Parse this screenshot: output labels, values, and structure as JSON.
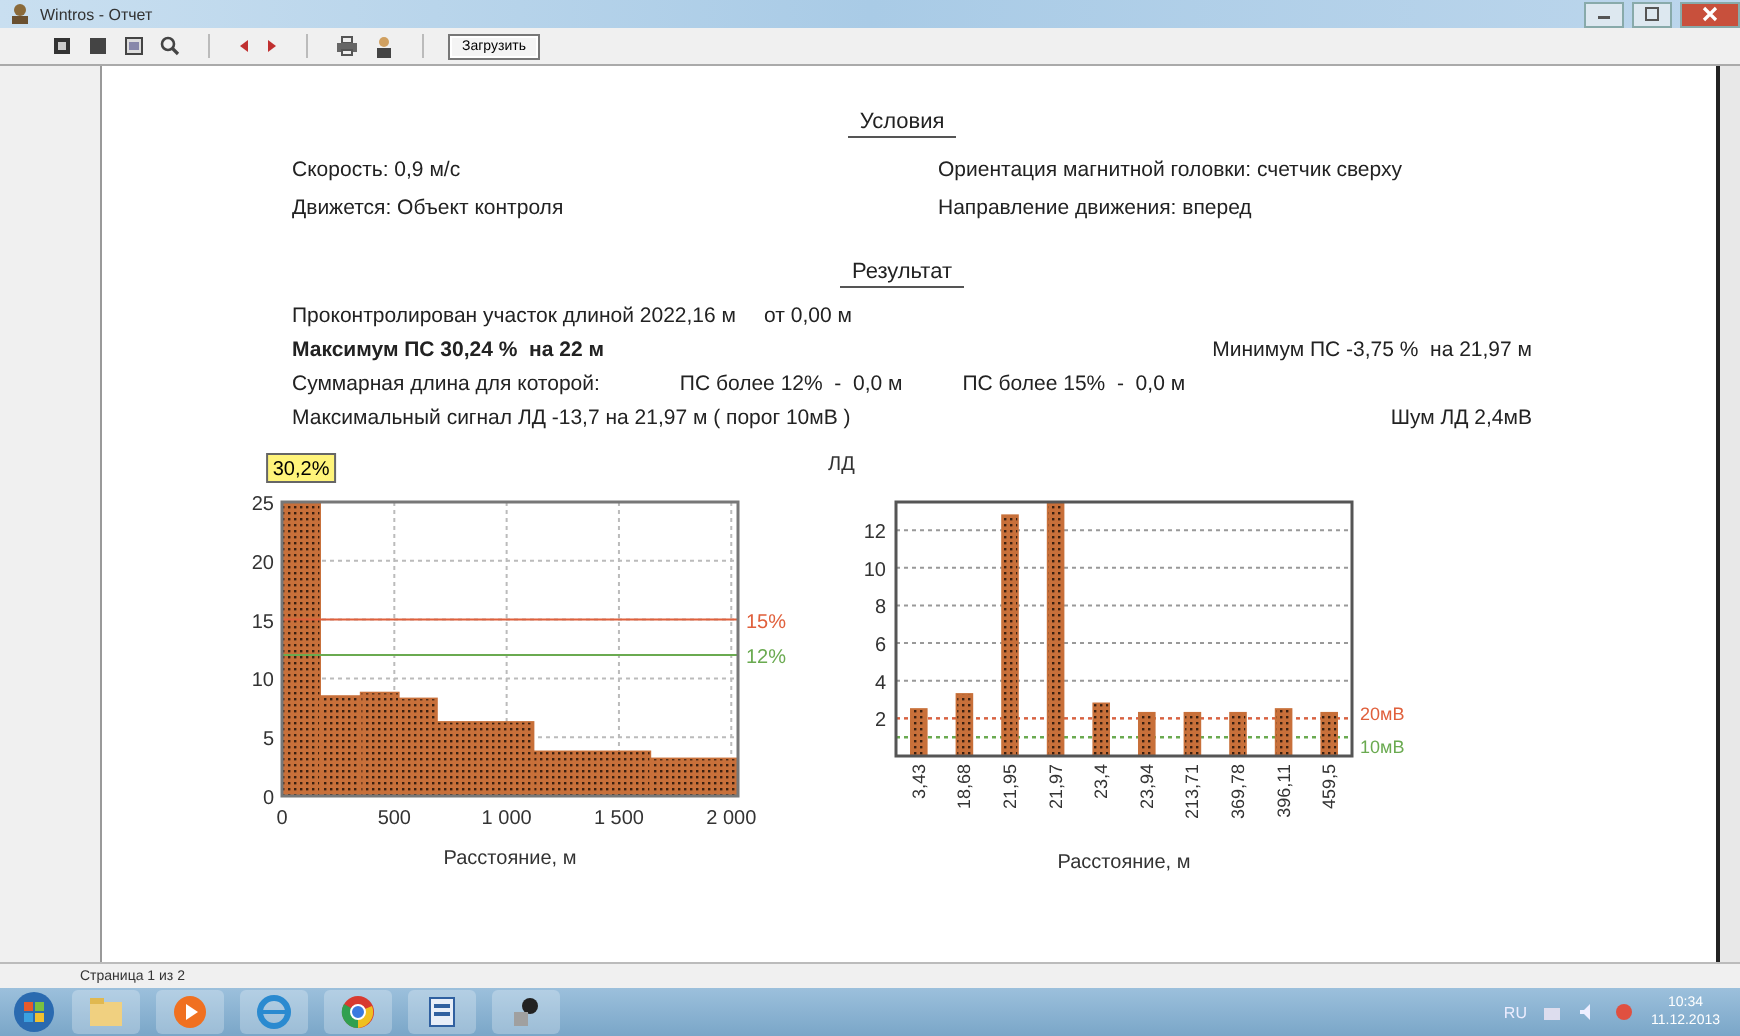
{
  "window": {
    "title": "Wintros - Отчет"
  },
  "toolbar": {
    "button": "Загрузить"
  },
  "report": {
    "conditions": {
      "heading": "Условия",
      "left": [
        "Скорость: 0,9 м/с",
        "Движется: Объект контроля"
      ],
      "right": [
        "Ориентация магнитной головки: счетчик сверху",
        "Направление движения: вперед"
      ]
    },
    "result": {
      "heading": "Результат",
      "rows": [
        {
          "cells": [
            {
              "text": "Проконтролирован участок длиной 2022,16 м",
              "bold": false
            },
            {
              "text": "от 0,00 м",
              "bold": false
            }
          ]
        },
        {
          "cells": [
            {
              "text": "Максимум ПС 30,24 %  на 22 м",
              "bold": true
            }
          ],
          "right": "Минимум ПС -3,75 %  на 21,97 м"
        },
        {
          "cells": [
            {
              "text": "Суммарная длина для которой:",
              "bold": false
            },
            {
              "text": "ПС более 12%  -  0,0 м",
              "bold": false
            },
            {
              "text": "ПС более 15%  -  0,0 м",
              "bold": false
            }
          ]
        },
        {
          "cells": [
            {
              "text": "Максимальный сигнал ЛД -13,7 на 21,97 м ( порог 10мВ )",
              "bold": false
            }
          ],
          "right": "Шум ЛД 2,4мВ"
        }
      ]
    },
    "charts": [
      {
        "chart_data": {
          "type": "bar",
          "xlabel": "Расстояние, м",
          "x": [
            85,
            260,
            435,
            605,
            905,
            1380,
            1835
          ],
          "grid": true,
          "series": [
            {
              "color": "#c8703a",
              "values": [
                25,
                8.5,
                8.8,
                8.3,
                6.3,
                3.8,
                3.2
              ]
            }
          ],
          "xlim": [
            0,
            2030
          ],
          "ylim": [
            0,
            25
          ],
          "xticks": [
            0,
            500,
            {
              "value": 1000,
              "label": "1 000"
            },
            {
              "value": 1500,
              "label": "1 500"
            },
            {
              "value": 2000,
              "label": "2 000"
            }
          ],
          "yticks": [
            0,
            5,
            10,
            15,
            20,
            25
          ],
          "annotations": [
            {
              "text": "30,2%",
              "x": 85,
              "y": 25
            }
          ],
          "ref_lines": [
            {
              "axis": "y",
              "value": 15,
              "label": "15%",
              "color": "#e0603c"
            },
            {
              "axis": "y",
              "value": 12,
              "label": "12%",
              "color": "#6aaa50"
            }
          ]
        }
      },
      {
        "chart_data": {
          "type": "bar",
          "xlabel": "Расстояние, м",
          "ylabel": "ЛД",
          "grid": true,
          "categories": [
            "3,43",
            "18,68",
            "21,95",
            "21,97",
            "23,4",
            "23,94",
            "213,71",
            "369,78",
            "396,11",
            "459,5"
          ],
          "series": [
            {
              "color": "#c8703a",
              "values": [
                2.5,
                3.3,
                12.8,
                13.5,
                2.8,
                2.3,
                2.3,
                2.3,
                2.5,
                2.3
              ]
            }
          ],
          "ylim": [
            0,
            13.5
          ],
          "yticks": [
            2,
            4,
            6,
            8,
            10,
            12
          ],
          "ref_lines": [
            {
              "axis": "y",
              "value": 2,
              "label": "20мВ",
              "color": "#e0603c"
            },
            {
              "axis": "y",
              "value": 1,
              "label": "10мВ",
              "color": "#6aaa50"
            }
          ]
        }
      }
    ]
  },
  "status_bar": {
    "page": "Страница 1 из 2"
  },
  "taskbar": {
    "tray": {
      "language": "RU",
      "time": "10:34",
      "date": "11.12.2013"
    }
  }
}
